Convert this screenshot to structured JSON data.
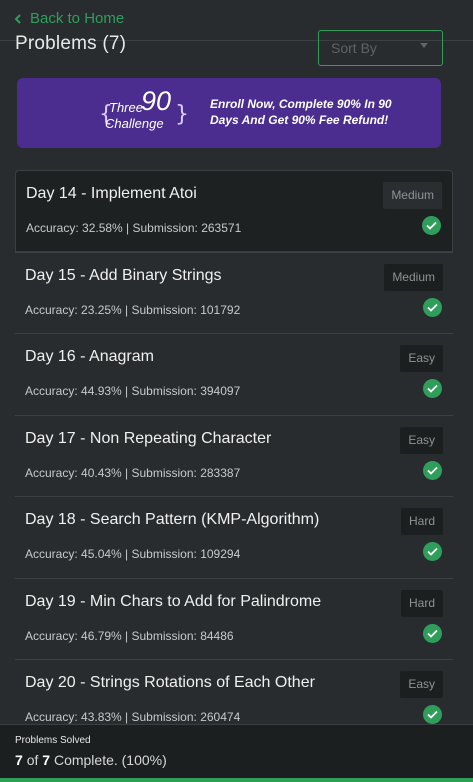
{
  "nav": {
    "back_label": "Back to Home"
  },
  "header": {
    "title": "Problems (7)",
    "sort_placeholder": "Sort By"
  },
  "banner": {
    "logo_three": "Three",
    "logo_ninety": "90",
    "logo_challenge": "Challenge",
    "text": "Enroll Now, Complete 90% In 90 Days And Get 90% Fee Refund!"
  },
  "problems": [
    {
      "title": "Day 14 - Implement Atoi",
      "meta": "Accuracy: 32.58% | Submission: 263571",
      "difficulty": "Medium",
      "solved": true
    },
    {
      "title": "Day 15 - Add Binary Strings",
      "meta": "Accuracy: 23.25% | Submission: 101792",
      "difficulty": "Medium",
      "solved": true
    },
    {
      "title": "Day 16 - Anagram",
      "meta": "Accuracy: 44.93% | Submission: 394097",
      "difficulty": "Easy",
      "solved": true
    },
    {
      "title": "Day 17 - Non Repeating Character",
      "meta": "Accuracy: 40.43% | Submission: 283387",
      "difficulty": "Easy",
      "solved": true
    },
    {
      "title": "Day 18 - Search Pattern (KMP-Algorithm)",
      "meta": "Accuracy: 45.04% | Submission: 109294",
      "difficulty": "Hard",
      "solved": true
    },
    {
      "title": "Day 19 - Min Chars to Add for Palindrome",
      "meta": "Accuracy: 46.79% | Submission: 84486",
      "difficulty": "Hard",
      "solved": true
    },
    {
      "title": "Day 20 - Strings Rotations of Each Other",
      "meta": "Accuracy: 43.83% | Submission: 260474",
      "difficulty": "Easy",
      "solved": true
    }
  ],
  "footer": {
    "label": "Problems Solved",
    "solved": "7",
    "of": "of",
    "total": "7",
    "complete_text": "Complete. (100%)",
    "progress_percent": 100
  },
  "colors": {
    "accent": "#2f9e5b",
    "banner_bg": "#4a2d8f",
    "page_bg": "#282c2e"
  }
}
